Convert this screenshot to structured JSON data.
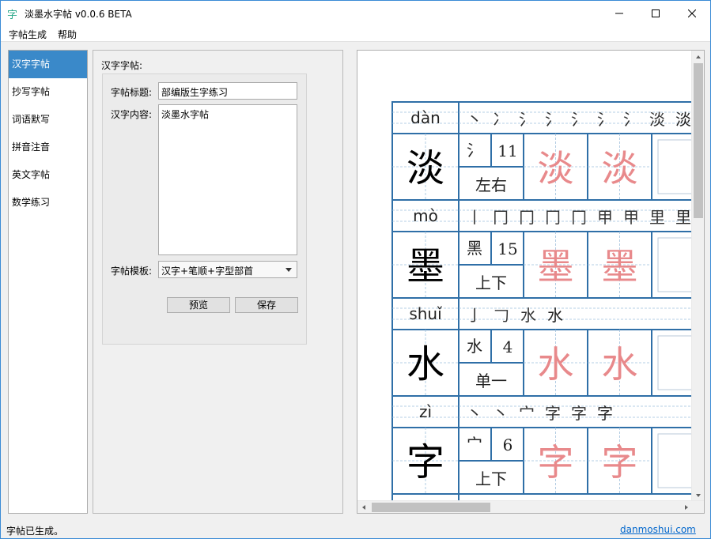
{
  "window": {
    "title": "淡墨水字帖 v0.0.6 BETA",
    "app_icon_glyph": "字"
  },
  "menu": [
    "字帖生成",
    "帮助"
  ],
  "sidebar": {
    "items": [
      {
        "label": "汉字字帖",
        "active": true
      },
      {
        "label": "抄写字帖"
      },
      {
        "label": "词语默写"
      },
      {
        "label": "拼音注音"
      },
      {
        "label": "英文字帖"
      },
      {
        "label": "数学练习"
      }
    ]
  },
  "form": {
    "group_title": "汉字字帖:",
    "title_label": "字帖标题:",
    "title_value": "部编版生字练习",
    "content_label": "汉字内容:",
    "content_value": "淡墨水字帖",
    "template_label": "字帖模板:",
    "template_value": "汉字+笔顺+字型部首",
    "preview_button": "预览",
    "save_button": "保存"
  },
  "sheet": {
    "chars": [
      {
        "char": "淡",
        "pinyin": "dàn",
        "radical": "氵",
        "strokes": "11",
        "structure": "左右",
        "stroke_order": [
          "丶",
          "冫",
          "氵",
          "氵",
          "氵",
          "氵",
          "氵",
          "淡",
          "淡"
        ]
      },
      {
        "char": "墨",
        "pinyin": "mò",
        "radical": "黑",
        "strokes": "15",
        "structure": "上下",
        "stroke_order": [
          "丨",
          "冂",
          "冂",
          "冂",
          "冂",
          "甲",
          "甲",
          "里",
          "里"
        ]
      },
      {
        "char": "水",
        "pinyin": "shuǐ",
        "radical": "水",
        "strokes": "4",
        "structure": "单一",
        "stroke_order": [
          "亅",
          "𠃌",
          "水",
          "水"
        ]
      },
      {
        "char": "字",
        "pinyin": "zì",
        "radical": "宀",
        "strokes": "6",
        "structure": "上下",
        "stroke_order": [
          "丶",
          "丶",
          "宀",
          "字",
          "字",
          "字"
        ]
      }
    ]
  },
  "status": {
    "text": "字帖已生成。",
    "link": "danmoshui.com"
  },
  "colors": {
    "accent": "#3a89c9",
    "grid": "#2f6fa7",
    "trace": "#e8898b",
    "stroke_red": "#e0303a",
    "link": "#0066cc"
  }
}
